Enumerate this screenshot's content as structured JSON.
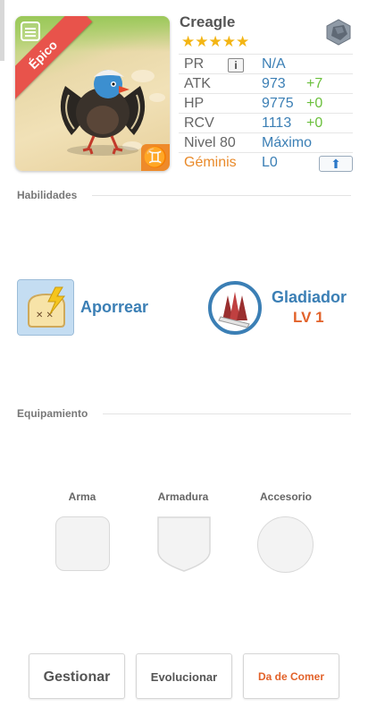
{
  "monster": {
    "name": "Creagle",
    "rarity": "Épico",
    "stars": "★★★★★",
    "zodiac_symbol": "♊"
  },
  "stats": {
    "pr_label": "PR",
    "pr_info": "i",
    "pr_value": "N/A",
    "atk_label": "ATK",
    "atk_value": "973",
    "atk_bonus": "+7",
    "hp_label": "HP",
    "hp_value": "9775",
    "hp_bonus": "+0",
    "rcv_label": "RCV",
    "rcv_value": "1113",
    "rcv_bonus": "+0",
    "level_label": "Nivel 80",
    "level_value": "Máximo",
    "sign_label": "Géminis",
    "sign_value": "L0",
    "upgrade_arrow": "⬆"
  },
  "skills": {
    "section_title": "Habilidades",
    "active_name": "Aporrear",
    "leader_name": "Gladiador",
    "leader_level": "LV 1"
  },
  "equipment": {
    "section_title": "Equipamiento",
    "weapon_label": "Arma",
    "armor_label": "Armadura",
    "accessory_label": "Accesorio"
  },
  "actions": {
    "manage": "Gestionar",
    "evolve": "Evolucionar",
    "feed": "Da de Comer"
  },
  "colors": {
    "accent_blue": "#3b7fb5",
    "bonus_green": "#6abf3c",
    "orange": "#e2622a",
    "rarity_red": "#e8534b",
    "star_gold": "#f3b514"
  }
}
